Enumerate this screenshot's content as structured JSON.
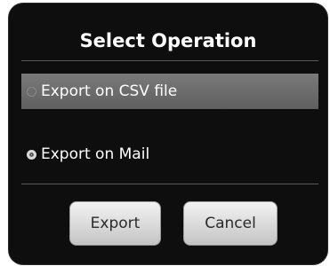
{
  "dialog": {
    "title": "Select Operation",
    "options": [
      {
        "label": "Export on CSV file",
        "selected": false
      },
      {
        "label": "Export on Mail",
        "selected": true
      }
    ],
    "buttons": {
      "export": "Export",
      "cancel": "Cancel"
    }
  },
  "colors": {
    "dialog_bg": "#0e0e0e",
    "highlight_row": "#6e6e6e",
    "button_bg": "#e0e0e0"
  }
}
